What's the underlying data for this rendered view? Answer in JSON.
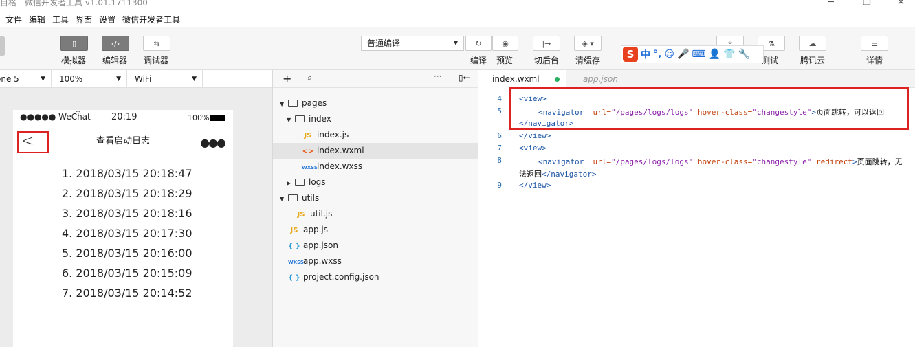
{
  "window": {
    "title": "目格 - 微信开发者工具 v1.01.1711300"
  },
  "menu": [
    "文件",
    "编辑",
    "工具",
    "界面",
    "设置",
    "微信开发者工具"
  ],
  "toolbar": {
    "simulator": "模拟器",
    "editor": "编辑器",
    "debugger": "调试器",
    "compile_mode": "普通编译",
    "compile": "编译",
    "preview": "预览",
    "background": "切后台",
    "clear_cache": "清缓存",
    "test": "测试",
    "tencent_cloud": "腾讯云",
    "details": "详情"
  },
  "ime": {
    "mode": "中"
  },
  "sim": {
    "device": "one 5",
    "zoom": "100%",
    "network": "WiFi"
  },
  "phone": {
    "carrier": "●●●●● WeChat",
    "time": "20:19",
    "battery": "100%",
    "nav_title": "查看启动日志",
    "logs": [
      "1. 2018/03/15 20:18:47",
      "2. 2018/03/15 20:18:29",
      "3. 2018/03/15 20:18:16",
      "4. 2018/03/15 20:17:30",
      "5. 2018/03/15 20:16:00",
      "6. 2018/03/15 20:15:09",
      "7. 2018/03/15 20:14:52"
    ]
  },
  "tree": {
    "pages": "pages",
    "index": "index",
    "index_js": "index.js",
    "index_wxml": "index.wxml",
    "index_wxss": "index.wxss",
    "logs": "logs",
    "utils": "utils",
    "util_js": "util.js",
    "app_js": "app.js",
    "app_json": "app.json",
    "app_wxss": "app.wxss",
    "project_config": "project.config.json"
  },
  "tabs": {
    "active": "index.wxml",
    "inactive": "app.json"
  },
  "code": {
    "l4": "4",
    "l5": "5",
    "l6": "6",
    "l7": "7",
    "l8": "8",
    "l9": "9",
    "view_open": "<view>",
    "view_close": "</view>",
    "nav_open": "<navigator",
    "url_attr": "url=",
    "url_val": "\"/pages/logs/logs\"",
    "hover_attr": "hover-class=",
    "hover_val": "\"changestyle\"",
    "redirect": "redirect",
    "gt": ">",
    "text1": "页面跳转，可以返回",
    "nav_close": "</navigator>",
    "text2a": "页面跳转，无",
    "text2b": "法返回"
  }
}
